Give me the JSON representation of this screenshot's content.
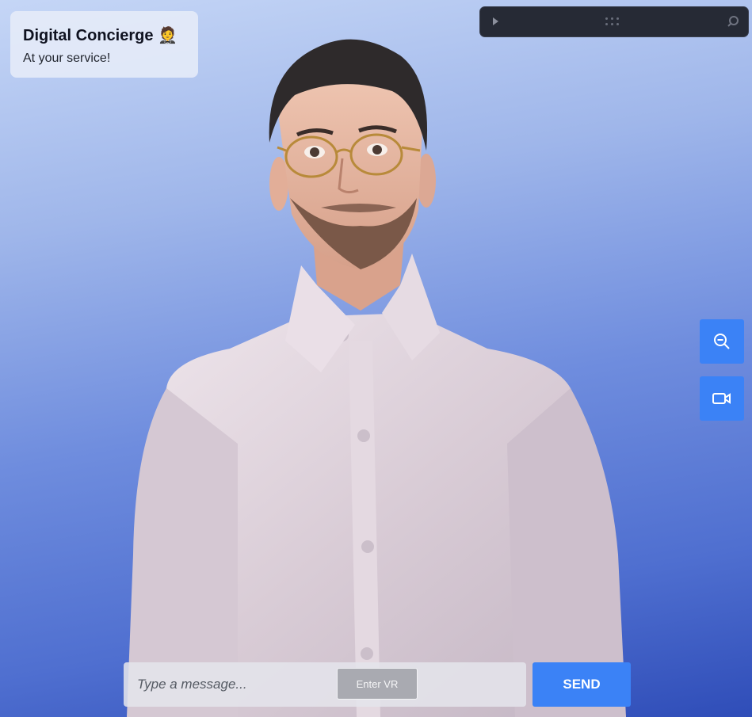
{
  "header": {
    "title": "Digital Concierge",
    "title_emoji": "🤵",
    "subtitle": "At your service!"
  },
  "devtool": {
    "icons": [
      "play-icon",
      "grip-icon",
      "inspect-icon"
    ]
  },
  "side_controls": {
    "zoom_icon": "zoom-out-icon",
    "camera_icon": "video-camera-icon"
  },
  "chat": {
    "placeholder": "Type a message...",
    "vr_label": "Enter VR",
    "send_label": "SEND"
  },
  "colors": {
    "accent": "#3b82f6",
    "background_top": "#c5d6f6",
    "background_bottom": "#2f4db8"
  }
}
